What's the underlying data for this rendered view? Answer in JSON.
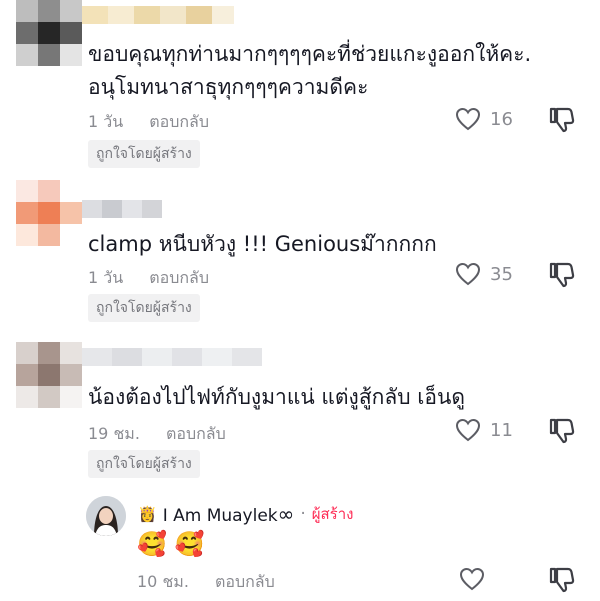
{
  "comments": [
    {
      "text_line1": "ขอบคุณทุกท่านมากๆๆๆๆคะที่ช่วยแกะงูออกให้คะ.",
      "text_line2": "อนุโมทนาสาธุทุกๆๆๆความดีคะ",
      "time": "1 วัน",
      "reply_label": "ตอบกลับ",
      "liked_by_creator": "ถูกใจโดยผู้สร้าง",
      "likes": "16"
    },
    {
      "text_line1": "clamp หนีบหัวงู !!! Geniousม๊ากกกก",
      "time": "1 วัน",
      "reply_label": "ตอบกลับ",
      "liked_by_creator": "ถูกใจโดยผู้สร้าง",
      "likes": "35"
    },
    {
      "text_line1": "น้องต้องไปไฟท์กับงูมาแน่ แต่งูสู้กลับ เอ็นดู",
      "time": "19 ชม.",
      "reply_label": "ตอบกลับ",
      "liked_by_creator": "ถูกใจโดยผู้สร้าง",
      "likes": "11"
    }
  ],
  "reply": {
    "username": "I Am Muaylek",
    "username_suffix": "∞",
    "dot": "·",
    "creator_label": "ผู้สร้าง",
    "emojis": "🥰 🥰",
    "time": "10 ชม.",
    "reply_label": "ตอบกลับ"
  },
  "colors": {
    "text": "#161823",
    "muted": "#8a8b91",
    "badge_bg": "#f1f1f2",
    "creator_accent": "#fe2c55"
  },
  "icons": [
    "heart-outline-icon",
    "thumbs-down-icon",
    "crown-emoji-icon",
    "smiling-face-hearts-emoji"
  ]
}
